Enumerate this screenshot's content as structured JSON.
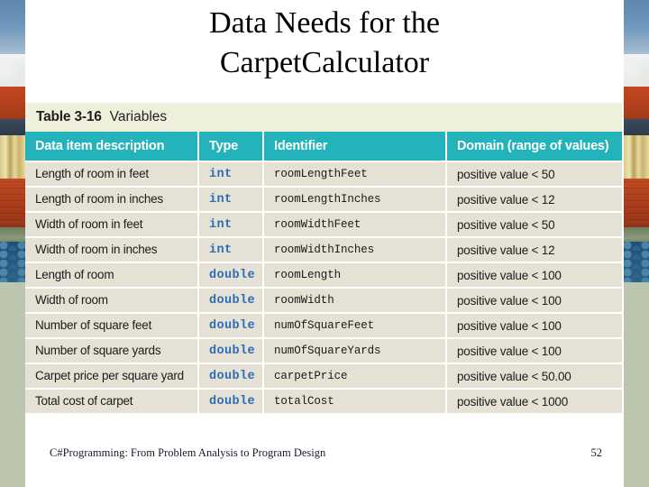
{
  "slide": {
    "title_line1": "Data Needs for the",
    "title_line2": "CarpetCalculator"
  },
  "table": {
    "caption_label": "Table 3-16",
    "caption_name": "Variables",
    "columns": [
      "Data item description",
      "Type",
      "Identifier",
      "Domain (range of values)"
    ],
    "rows": [
      {
        "description": "Length of room in feet",
        "type": "int",
        "identifier": "roomLengthFeet",
        "domain": "positive value < 50"
      },
      {
        "description": "Length of room in inches",
        "type": "int",
        "identifier": "roomLengthInches",
        "domain": "positive value < 12"
      },
      {
        "description": "Width of room in feet",
        "type": "int",
        "identifier": "roomWidthFeet",
        "domain": "positive value < 50"
      },
      {
        "description": "Width of room in inches",
        "type": "int",
        "identifier": "roomWidthInches",
        "domain": "positive value < 12"
      },
      {
        "description": "Length of room",
        "type": "double",
        "identifier": "roomLength",
        "domain": "positive value < 100"
      },
      {
        "description": "Width of room",
        "type": "double",
        "identifier": "roomWidth",
        "domain": "positive value < 100"
      },
      {
        "description": "Number of square feet",
        "type": "double",
        "identifier": "numOfSquareFeet",
        "domain": "positive value < 100"
      },
      {
        "description": "Number of square yards",
        "type": "double",
        "identifier": "numOfSquareYards",
        "domain": "positive value < 100"
      },
      {
        "description": "Carpet price per square yard",
        "type": "double",
        "identifier": "carpetPrice",
        "domain": "positive value < 50.00"
      },
      {
        "description": "Total cost of carpet",
        "type": "double",
        "identifier": "totalCost",
        "domain": "positive value < 1000"
      }
    ]
  },
  "footer": {
    "text": "C#Programming: From Problem Analysis to Program Design",
    "page": "52"
  },
  "colors": {
    "header_teal": "#24b2bb",
    "caption_cream": "#eef0dc",
    "row_beige": "#e5e1d4",
    "type_blue": "#2a6cb5",
    "sage_border": "#bcc6ae"
  }
}
